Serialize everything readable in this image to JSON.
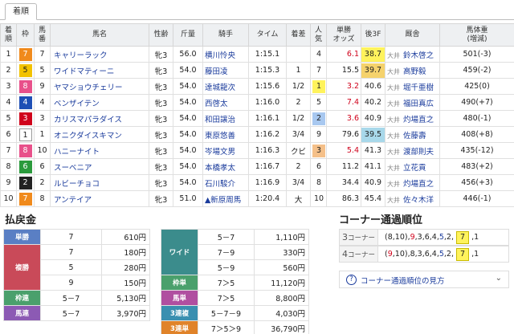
{
  "tab": {
    "label": "着順"
  },
  "headers": {
    "pos": "着\n順",
    "frame": "枠",
    "num": "馬\n番",
    "name": "馬名",
    "sex": "性齢",
    "wt": "斤量",
    "jockey": "騎手",
    "time": "タイム",
    "margin": "着差",
    "pop": "人\n気",
    "odds": "単勝\nオッズ",
    "l3f": "後3F",
    "trainer": "厩舎",
    "bw": "馬体重\n(増減)"
  },
  "rows": [
    {
      "pos": "1",
      "frame": "7",
      "num": "7",
      "name": "キャリーラック",
      "sex": "牝3",
      "wt": "56.0",
      "jockey": "横川怜央",
      "time": "1:15.1",
      "margin": "",
      "pop": "4",
      "odds": "6.1",
      "l3f": "38.7",
      "area": "大井",
      "trainer": "鈴木啓之",
      "bw": "501(-3)"
    },
    {
      "pos": "2",
      "frame": "5",
      "num": "5",
      "name": "ワイドマティーニ",
      "sex": "牝3",
      "wt": "54.0",
      "jockey": "藤田凌",
      "time": "1:15.3",
      "margin": "1",
      "pop": "7",
      "odds": "15.5",
      "l3f": "39.7",
      "area": "大井",
      "trainer": "高野毅",
      "bw": "459(-2)"
    },
    {
      "pos": "3",
      "frame": "8",
      "num": "9",
      "name": "ヤマショウチェリー",
      "sex": "牝3",
      "wt": "54.0",
      "jockey": "達城龍次",
      "time": "1:15.6",
      "margin": "1/2",
      "pop": "1",
      "odds": "3.2",
      "l3f": "40.6",
      "area": "大井",
      "trainer": "堀千亜樹",
      "bw": "425(0)"
    },
    {
      "pos": "4",
      "frame": "4",
      "num": "4",
      "name": "ベンザイテン",
      "sex": "牝3",
      "wt": "54.0",
      "jockey": "西啓太",
      "time": "1:16.0",
      "margin": "2",
      "pop": "5",
      "odds": "7.4",
      "l3f": "40.2",
      "area": "大井",
      "trainer": "福田真広",
      "bw": "490(+7)"
    },
    {
      "pos": "5",
      "frame": "3",
      "num": "3",
      "name": "カリスマパラダイス",
      "sex": "牝3",
      "wt": "54.0",
      "jockey": "和田譲治",
      "time": "1:16.1",
      "margin": "1/2",
      "pop": "2",
      "odds": "3.6",
      "l3f": "40.9",
      "area": "大井",
      "trainer": "灼場直之",
      "bw": "480(-1)"
    },
    {
      "pos": "6",
      "frame": "1",
      "num": "1",
      "name": "オニクダイスキマン",
      "sex": "牝3",
      "wt": "54.0",
      "jockey": "東原悠善",
      "time": "1:16.2",
      "margin": "3/4",
      "pop": "9",
      "odds": "79.6",
      "l3f": "39.5",
      "area": "大井",
      "trainer": "佐藤壽",
      "bw": "408(+8)"
    },
    {
      "pos": "7",
      "frame": "8",
      "num": "10",
      "name": "ハニーナイト",
      "sex": "牝3",
      "wt": "54.0",
      "jockey": "岑場文男",
      "time": "1:16.3",
      "margin": "クビ",
      "pop": "3",
      "odds": "5.4",
      "l3f": "41.3",
      "area": "大井",
      "trainer": "渡部則夫",
      "bw": "435(-12)"
    },
    {
      "pos": "8",
      "frame": "6",
      "num": "6",
      "name": "スーベニア",
      "sex": "牝3",
      "wt": "54.0",
      "jockey": "本橋孝太",
      "time": "1:16.7",
      "margin": "2",
      "pop": "6",
      "odds": "11.2",
      "l3f": "41.1",
      "area": "大井",
      "trainer": "立花貢",
      "bw": "483(+2)"
    },
    {
      "pos": "9",
      "frame": "2",
      "num": "2",
      "name": "ルビーチョコ",
      "sex": "牝3",
      "wt": "54.0",
      "jockey": "石川駿介",
      "time": "1:16.9",
      "margin": "3/4",
      "pop": "8",
      "odds": "34.4",
      "l3f": "40.9",
      "area": "大井",
      "trainer": "灼場直之",
      "bw": "456(+3)"
    },
    {
      "pos": "10",
      "frame": "7",
      "num": "8",
      "name": "アンテイア",
      "sex": "牝3",
      "wt": "51.0",
      "jockey": "▲新原周馬",
      "time": "1:20.4",
      "margin": "大",
      "pop": "10",
      "odds": "86.3",
      "l3f": "45.4",
      "area": "大井",
      "trainer": "佐々木洋",
      "bw": "446(-1)"
    }
  ],
  "payout": {
    "title": "払戻金",
    "left": [
      {
        "label": "単勝",
        "color": "#5a7fc4",
        "entries": [
          {
            "num": "7",
            "amt": "610円"
          }
        ]
      },
      {
        "label": "複勝",
        "color": "#c94a59",
        "entries": [
          {
            "num": "7",
            "amt": "180円"
          },
          {
            "num": "5",
            "amt": "280円"
          },
          {
            "num": "9",
            "amt": "150円"
          }
        ]
      },
      {
        "label": "枠連",
        "color": "#4aa06c",
        "entries": [
          {
            "num": "5－7",
            "amt": "5,130円"
          }
        ]
      },
      {
        "label": "馬連",
        "color": "#8c5ab4",
        "entries": [
          {
            "num": "5－7",
            "amt": "3,970円"
          }
        ]
      }
    ],
    "right": [
      {
        "label": "ワイド",
        "color": "#3b8c8c",
        "entries": [
          {
            "num": "5－7",
            "amt": "1,110円"
          },
          {
            "num": "7－9",
            "amt": "330円"
          },
          {
            "num": "5－9",
            "amt": "560円"
          }
        ]
      },
      {
        "label": "枠単",
        "color": "#4aa06c",
        "entries": [
          {
            "num": "7＞5",
            "amt": "11,120円"
          }
        ]
      },
      {
        "label": "馬単",
        "color": "#b04fa0",
        "entries": [
          {
            "num": "7＞5",
            "amt": "8,800円"
          }
        ]
      },
      {
        "label": "3連複",
        "color": "#3a8fb0",
        "entries": [
          {
            "num": "5－7－9",
            "amt": "4,030円"
          }
        ]
      },
      {
        "label": "3連単",
        "color": "#e0832a",
        "entries": [
          {
            "num": "7＞5＞9",
            "amt": "36,790円"
          }
        ]
      }
    ]
  },
  "corners": {
    "title": "コーナー通過順位",
    "c3": {
      "num": "3",
      "label": "コーナー"
    },
    "c4": {
      "num": "4",
      "label": "コーナー"
    },
    "howto": "コーナー通過順位の見方"
  },
  "colors": {
    "frame1": "#ffffff",
    "frame2": "#222222",
    "frame3": "#d0021b",
    "frame4": "#1e4fb5",
    "frame5": "#f2c200",
    "frame6": "#2a9a3c",
    "frame7": "#f08a1c",
    "frame8": "#e8508a"
  }
}
